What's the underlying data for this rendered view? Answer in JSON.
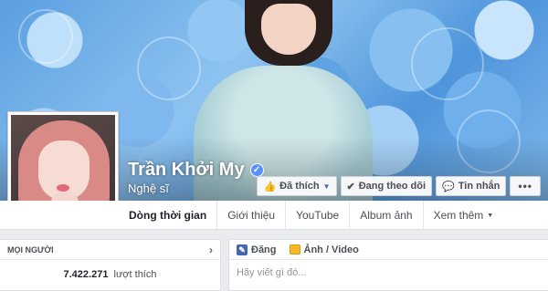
{
  "profile": {
    "name": "Trần Khởi My",
    "verified_icon": "verified-check-icon",
    "category": "Nghệ sĩ"
  },
  "actions": {
    "liked_label": "Đã thích",
    "following_label": "Đang theo dõi",
    "message_label": "Tin nhắn",
    "more_label": "•••"
  },
  "tabs": [
    {
      "label": "Dòng thời gian"
    },
    {
      "label": "Giới thiệu"
    },
    {
      "label": "YouTube"
    },
    {
      "label": "Album ảnh"
    },
    {
      "label": "Xem thêm"
    }
  ],
  "people_card": {
    "title": "MỌI NGƯỜI",
    "likes_count": "7.422.271",
    "likes_label": "lượt thích"
  },
  "composer": {
    "status_label": "Đăng",
    "photo_label": "Ảnh / Video",
    "placeholder": "Hãy viết gì đó..."
  },
  "colors": {
    "accent": "#4267b2",
    "verified": "#5890ff",
    "page_bg": "#e9ebee"
  }
}
